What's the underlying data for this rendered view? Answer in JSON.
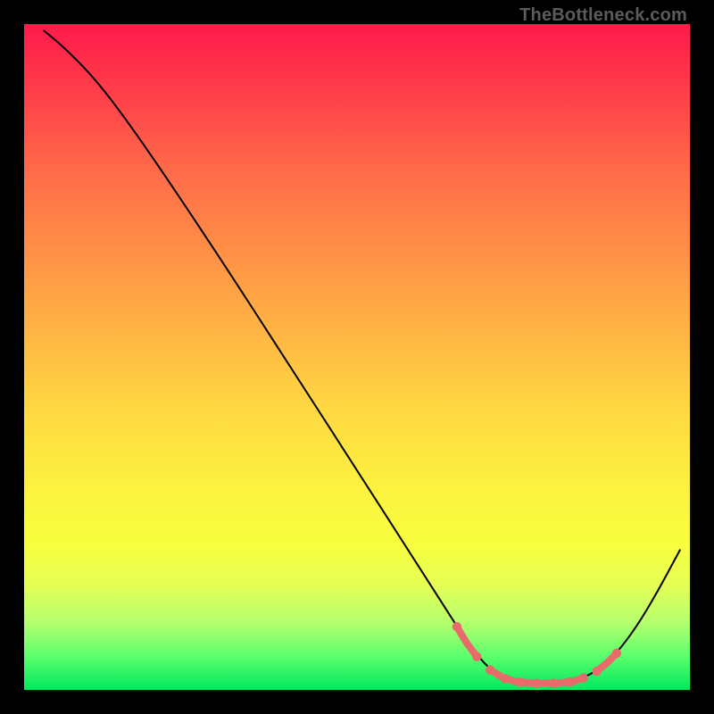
{
  "attribution": "TheBottleneck.com",
  "chart_data": {
    "type": "line",
    "title": "",
    "xlabel": "",
    "ylabel": "",
    "xlim": [
      0,
      100
    ],
    "ylim": [
      0,
      100
    ],
    "curve_points": [
      {
        "x": 3.0,
        "y": 99.0
      },
      {
        "x": 6.0,
        "y": 96.5
      },
      {
        "x": 10.0,
        "y": 92.5
      },
      {
        "x": 14.0,
        "y": 87.5
      },
      {
        "x": 20.0,
        "y": 79.0
      },
      {
        "x": 30.0,
        "y": 64.0
      },
      {
        "x": 40.0,
        "y": 48.5
      },
      {
        "x": 50.0,
        "y": 33.0
      },
      {
        "x": 58.0,
        "y": 20.5
      },
      {
        "x": 62.5,
        "y": 13.5
      },
      {
        "x": 66.0,
        "y": 8.0
      },
      {
        "x": 69.0,
        "y": 4.0
      },
      {
        "x": 71.5,
        "y": 2.0
      },
      {
        "x": 74.0,
        "y": 1.2
      },
      {
        "x": 77.0,
        "y": 1.0
      },
      {
        "x": 80.0,
        "y": 1.0
      },
      {
        "x": 83.0,
        "y": 1.4
      },
      {
        "x": 86.0,
        "y": 2.8
      },
      {
        "x": 89.0,
        "y": 5.5
      },
      {
        "x": 92.0,
        "y": 9.5
      },
      {
        "x": 95.0,
        "y": 14.5
      },
      {
        "x": 98.5,
        "y": 21.0
      }
    ],
    "accent_segments": [
      {
        "points": [
          {
            "x": 65.0,
            "y": 9.5
          },
          {
            "x": 66.5,
            "y": 7.0
          },
          {
            "x": 68.0,
            "y": 5.0
          }
        ]
      },
      {
        "points": [
          {
            "x": 70.0,
            "y": 3.0
          },
          {
            "x": 72.0,
            "y": 1.8
          },
          {
            "x": 74.0,
            "y": 1.2
          },
          {
            "x": 77.0,
            "y": 1.0
          },
          {
            "x": 80.0,
            "y": 1.0
          },
          {
            "x": 82.5,
            "y": 1.3
          },
          {
            "x": 84.0,
            "y": 1.8
          }
        ]
      },
      {
        "points": [
          {
            "x": 86.0,
            "y": 2.8
          },
          {
            "x": 87.5,
            "y": 4.0
          },
          {
            "x": 89.0,
            "y": 5.5
          }
        ]
      }
    ],
    "accent_dots": [
      {
        "x": 65.0,
        "y": 9.5
      },
      {
        "x": 68.0,
        "y": 5.0
      },
      {
        "x": 70.0,
        "y": 3.0
      },
      {
        "x": 72.2,
        "y": 1.7
      },
      {
        "x": 74.5,
        "y": 1.2
      },
      {
        "x": 77.0,
        "y": 1.0
      },
      {
        "x": 79.5,
        "y": 1.0
      },
      {
        "x": 82.0,
        "y": 1.2
      },
      {
        "x": 84.0,
        "y": 1.8
      },
      {
        "x": 86.0,
        "y": 2.8
      },
      {
        "x": 89.0,
        "y": 5.5
      }
    ]
  }
}
